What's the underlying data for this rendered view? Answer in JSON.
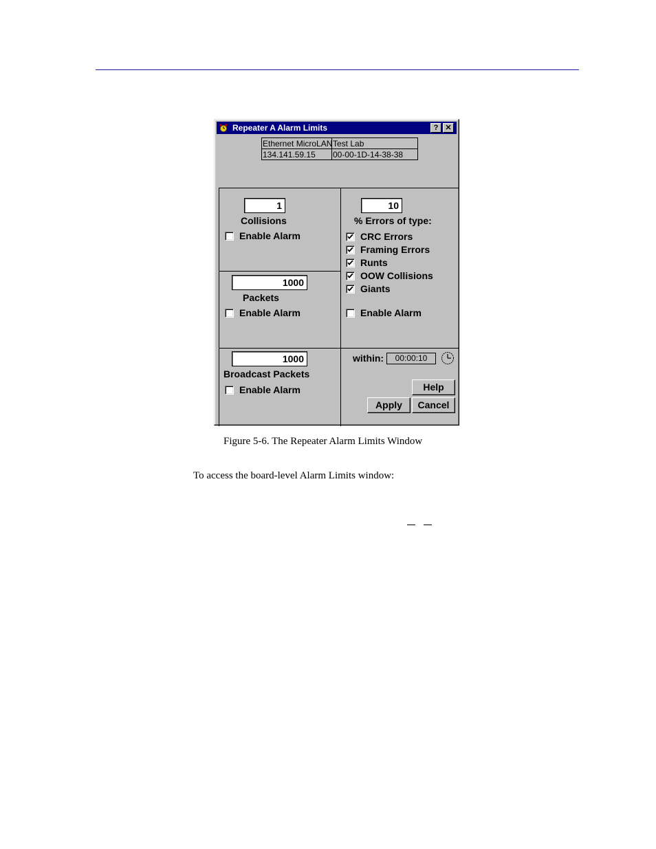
{
  "page": {
    "caption": "Figure 5-6.  The Repeater Alarm Limits Window",
    "body_text": "To access the board-level Alarm Limits window:",
    "header_rule_color": "#1a1aa6"
  },
  "window": {
    "title": "Repeater A Alarm Limits",
    "help_button": "?",
    "close_button": "✕",
    "info": {
      "device_name": "Ethernet MicroLAN",
      "location": "Test Lab",
      "ip_address": "134.141.59.15",
      "mac_address": "00-00-1D-14-38-38"
    },
    "collisions": {
      "value": "1",
      "label": "Collisions",
      "enable_alarm_label": "Enable Alarm",
      "enable_alarm_checked": false
    },
    "packets": {
      "value": "1000",
      "label": "Packets",
      "enable_alarm_label": "Enable Alarm",
      "enable_alarm_checked": false
    },
    "broadcast_packets": {
      "value": "1000",
      "label": "Broadcast Packets",
      "enable_alarm_label": "Enable Alarm",
      "enable_alarm_checked": false
    },
    "errors": {
      "value": "10",
      "label": "% Errors of type:",
      "types": [
        {
          "label": "CRC Errors",
          "checked": true
        },
        {
          "label": "Framing Errors",
          "checked": true
        },
        {
          "label": "Runts",
          "checked": true
        },
        {
          "label": "OOW Collisions",
          "checked": true
        },
        {
          "label": "Giants",
          "checked": true
        }
      ],
      "enable_alarm_label": "Enable Alarm",
      "enable_alarm_checked": false
    },
    "within": {
      "label": "within:",
      "value": "00:00:10"
    },
    "buttons": {
      "help": "Help",
      "apply": "Apply",
      "cancel": "Cancel"
    }
  }
}
